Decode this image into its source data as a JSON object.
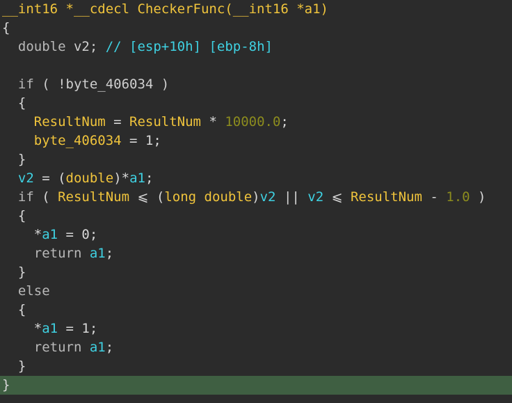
{
  "code": {
    "lines": [
      [
        {
          "t": "__int16 *__cdecl CheckerFunc(__int16 *a1)",
          "c": "y"
        }
      ],
      [
        {
          "t": "{",
          "c": "p"
        }
      ],
      [
        {
          "t": "  ",
          "c": "p"
        },
        {
          "t": "double",
          "c": "k"
        },
        {
          "t": " v2; ",
          "c": "g"
        },
        {
          "t": "// [esp+10h] [ebp-8h]",
          "c": "c"
        }
      ],
      [],
      [
        {
          "t": "  ",
          "c": "p"
        },
        {
          "t": "if",
          "c": "k"
        },
        {
          "t": " ( !byte_406034 )",
          "c": "g"
        }
      ],
      [
        {
          "t": "  {",
          "c": "p"
        }
      ],
      [
        {
          "t": "    ",
          "c": "p"
        },
        {
          "t": "ResultNum",
          "c": "y"
        },
        {
          "t": " = ",
          "c": "p"
        },
        {
          "t": "ResultNum",
          "c": "y"
        },
        {
          "t": " * ",
          "c": "p"
        },
        {
          "t": "10000.0",
          "c": "n"
        },
        {
          "t": ";",
          "c": "p"
        }
      ],
      [
        {
          "t": "    ",
          "c": "p"
        },
        {
          "t": "byte_406034",
          "c": "y"
        },
        {
          "t": " = 1;",
          "c": "p"
        }
      ],
      [
        {
          "t": "  }",
          "c": "p"
        }
      ],
      [
        {
          "t": "  ",
          "c": "p"
        },
        {
          "t": "v2",
          "c": "c"
        },
        {
          "t": " = (",
          "c": "p"
        },
        {
          "t": "double",
          "c": "y"
        },
        {
          "t": ")*",
          "c": "p"
        },
        {
          "t": "a1",
          "c": "c"
        },
        {
          "t": ";",
          "c": "p"
        }
      ],
      [
        {
          "t": "  ",
          "c": "p"
        },
        {
          "t": "if",
          "c": "k"
        },
        {
          "t": " ( ",
          "c": "p"
        },
        {
          "t": "ResultNum",
          "c": "y"
        },
        {
          "t": " ⩽ (",
          "c": "p"
        },
        {
          "t": "long double",
          "c": "y"
        },
        {
          "t": ")",
          "c": "p"
        },
        {
          "t": "v2",
          "c": "c"
        },
        {
          "t": " || ",
          "c": "p"
        },
        {
          "t": "v2",
          "c": "c"
        },
        {
          "t": " ⩽ ",
          "c": "p"
        },
        {
          "t": "ResultNum",
          "c": "y"
        },
        {
          "t": " - ",
          "c": "p"
        },
        {
          "t": "1.0",
          "c": "n"
        },
        {
          "t": " )",
          "c": "p"
        }
      ],
      [
        {
          "t": "  {",
          "c": "p"
        }
      ],
      [
        {
          "t": "    *",
          "c": "p"
        },
        {
          "t": "a1",
          "c": "c"
        },
        {
          "t": " = 0;",
          "c": "p"
        }
      ],
      [
        {
          "t": "    ",
          "c": "p"
        },
        {
          "t": "return",
          "c": "k"
        },
        {
          "t": " ",
          "c": "p"
        },
        {
          "t": "a1",
          "c": "c"
        },
        {
          "t": ";",
          "c": "p"
        }
      ],
      [
        {
          "t": "  }",
          "c": "p"
        }
      ],
      [
        {
          "t": "  ",
          "c": "p"
        },
        {
          "t": "else",
          "c": "k"
        }
      ],
      [
        {
          "t": "  {",
          "c": "p"
        }
      ],
      [
        {
          "t": "    *",
          "c": "p"
        },
        {
          "t": "a1",
          "c": "c"
        },
        {
          "t": " = 1;",
          "c": "p"
        }
      ],
      [
        {
          "t": "    ",
          "c": "p"
        },
        {
          "t": "return",
          "c": "k"
        },
        {
          "t": " ",
          "c": "p"
        },
        {
          "t": "a1",
          "c": "c"
        },
        {
          "t": ";",
          "c": "p"
        }
      ],
      [
        {
          "t": "  }",
          "c": "p"
        }
      ],
      [
        {
          "t": "}",
          "c": "p"
        }
      ]
    ],
    "current_line": 20
  }
}
